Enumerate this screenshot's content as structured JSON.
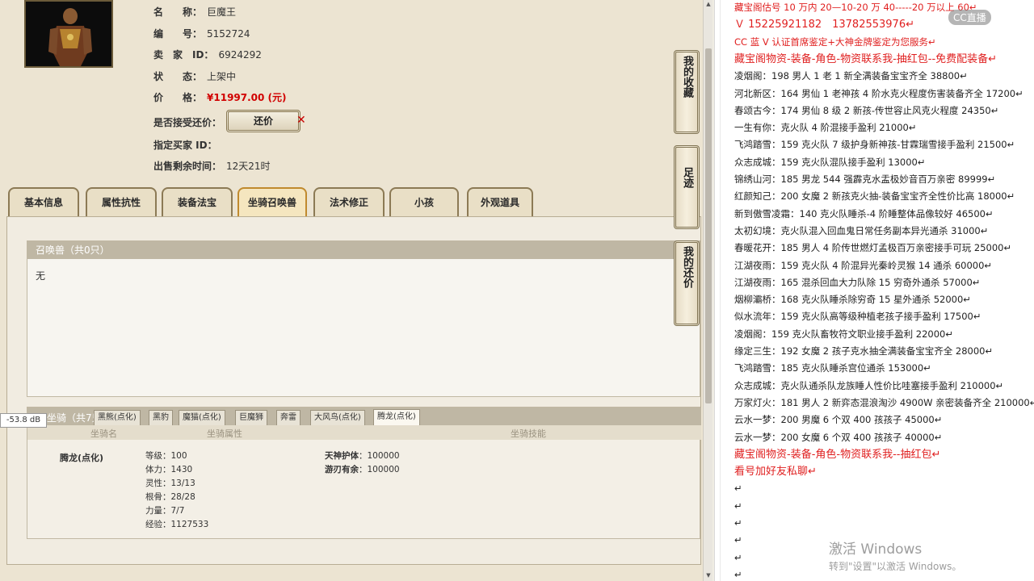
{
  "item": {
    "name_label": "名　　称：",
    "name": "巨魔王",
    "id_label": "编　　号：",
    "id": "5152724",
    "seller_label": "卖　家　ID：",
    "seller_id": "6924292",
    "status_label": "状　　态：",
    "status": "上架中",
    "price_label": "价　　格：",
    "price": "¥11997.00 (元)",
    "counter_label": "是否接受还价：",
    "counter_button": "还价",
    "buyer_label": "指定买家 ID：",
    "time_label": "出售剩余时间：",
    "time_left": "12天21时"
  },
  "tabs": [
    "基本信息",
    "属性抗性",
    "装备法宝",
    "坐骑召唤兽",
    "法术修正",
    "小孩",
    "外观道具"
  ],
  "summon": {
    "title": "召唤兽（共0只）",
    "content": "无"
  },
  "mount": {
    "title": "坐骑（共7只）",
    "tabs": [
      "黑熊(点化)",
      "黑豹",
      "魔猫(点化)",
      "巨魔狮",
      "奔雷",
      "大风鸟(点化)",
      "腾龙(点化)"
    ],
    "col_name": "坐骑名",
    "col_attr": "坐骑属性",
    "col_skill": "坐骑技能",
    "selected_name": "腾龙(点化)",
    "attrs": [
      "等级：100",
      "体力：1430",
      "灵性：13/13",
      "根骨：28/28",
      "力量：7/7",
      "经验：1127533"
    ],
    "skills": [
      {
        "name": "天神护体",
        "value": "：100000"
      },
      {
        "name": "游刃有余",
        "value": "：100000"
      }
    ]
  },
  "volume_tag": "-53.8 dB",
  "side_buttons": [
    "我的收藏",
    "足迹",
    "我的还价"
  ],
  "notes": [
    {
      "text": "藏宝阁估号 10 万内 20—10-20 万 40-----20 万以上 60↵",
      "red": true
    },
    {
      "text": "Ｖ 15225921182　13782553976↵",
      "red": true,
      "big": true
    },
    {
      "text": "CC 蓝 V 认证首席鉴定+大神金牌鉴定为您服务↵",
      "red": true
    },
    {
      "text": "藏宝阁物资-装备-角色-物资联系我-抽红包--免费配装备↵",
      "red": true,
      "big": true
    },
    {
      "text": "凌烟阁：198 男人 1 老 1 新全满装备宝宝齐全 38800↵"
    },
    {
      "text": "河北新区：164 男仙 1 老神孩 4 阶水克火程度伤害装备齐全 17200↵"
    },
    {
      "text": "春颂古今：174 男仙 8 级 2 新孩-传世容止风克火程度 24350↵"
    },
    {
      "text": "一生有你：克火队 4 阶混接手盈利 21000↵"
    },
    {
      "text": "飞鸿踏雪：159 克火队 7 级护身新神孩-甘霖瑞雪接手盈利 21500↵"
    },
    {
      "text": "众志成城：159 克火队混队接手盈利 13000↵"
    },
    {
      "text": "锦绣山河：185 男龙 544 强霹克水盂极妙音百万亲密 89999↵"
    },
    {
      "text": "红颜知己：200 女魔 2 新孩克火抽-装备宝宝齐全性价比高 18000↵"
    },
    {
      "text": "新到傲雪凌霜：140 克火队睡杀-4 阶睡整体品像较好 46500↵"
    },
    {
      "text": "太初幻境：克火队混入回血鬼日常任务副本异光通杀 31000↵"
    },
    {
      "text": "春暖花开：185 男人 4 阶传世燃灯孟极百万亲密接手可玩 25000↵"
    },
    {
      "text": "江湖夜雨：159 克火队 4 阶混异光秦岭灵猴 14 通杀 60000↵"
    },
    {
      "text": "江湖夜雨：165 混杀回血大力队除 15 穷奇外通杀 57000↵"
    },
    {
      "text": "烟柳灞桥：168 克火队睡杀除穷奇 15 星外通杀 52000↵"
    },
    {
      "text": "似水流年：159 克火队高等级种植老孩子接手盈利 17500↵"
    },
    {
      "text": "凌烟阁：159 克火队畜牧符文职业接手盈利 22000↵"
    },
    {
      "text": "缘定三生：192 女魔 2 孩子克水抽全满装备宝宝齐全 28000↵"
    },
    {
      "text": "飞鸿踏雪：185 克火队睡杀宫位通杀 153000↵"
    },
    {
      "text": "众志成城：克火队通杀队龙族睡人性价比哇塞接手盈利 210000↵"
    },
    {
      "text": "万家灯火：181 男人 2 新弈态混浪淘沙 4900W 亲密装备齐全 210000↵"
    },
    {
      "text": "云水一梦：200 男魔 6 个双 400 孩孩子 45000↵"
    },
    {
      "text": "云水一梦：200 女魔 6 个双 400 孩孩子 40000↵"
    },
    {
      "text": "藏宝阁物资-装备-角色-物资联系我--抽红包↵",
      "red": true,
      "big": true
    },
    {
      "text": "看号加好友私聊↵",
      "red": true,
      "big": true
    },
    {
      "text": "↵"
    },
    {
      "text": "↵"
    },
    {
      "text": "↵"
    },
    {
      "text": "↵"
    },
    {
      "text": "↵"
    },
    {
      "text": "↵"
    }
  ],
  "watermark": "CC直播",
  "activate": {
    "line1": "激活 Windows",
    "line2": "转到\"设置\"以激活 Windows。"
  }
}
